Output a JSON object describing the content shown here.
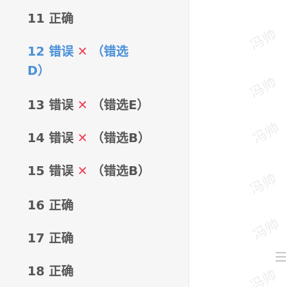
{
  "items": [
    {
      "num": "11",
      "status": "正确",
      "wrong": false
    },
    {
      "num": "12",
      "status": "错误",
      "wrong": true,
      "note_a": "（错选",
      "note_b": "D）",
      "active": true
    },
    {
      "num": "13",
      "status": "错误",
      "wrong": true,
      "note": "（错选E）"
    },
    {
      "num": "14",
      "status": "错误",
      "wrong": true,
      "note": "（错选B）"
    },
    {
      "num": "15",
      "status": "错误",
      "wrong": true,
      "note": "（错选B）"
    },
    {
      "num": "16",
      "status": "正确",
      "wrong": false
    },
    {
      "num": "17",
      "status": "正确",
      "wrong": false
    },
    {
      "num": "18",
      "status": "正确",
      "wrong": false
    }
  ],
  "x_symbol": "✕",
  "watermark": "冯帅",
  "colors": {
    "active": "#4a90d9",
    "wrong": "#f0384f",
    "text": "#555555"
  }
}
